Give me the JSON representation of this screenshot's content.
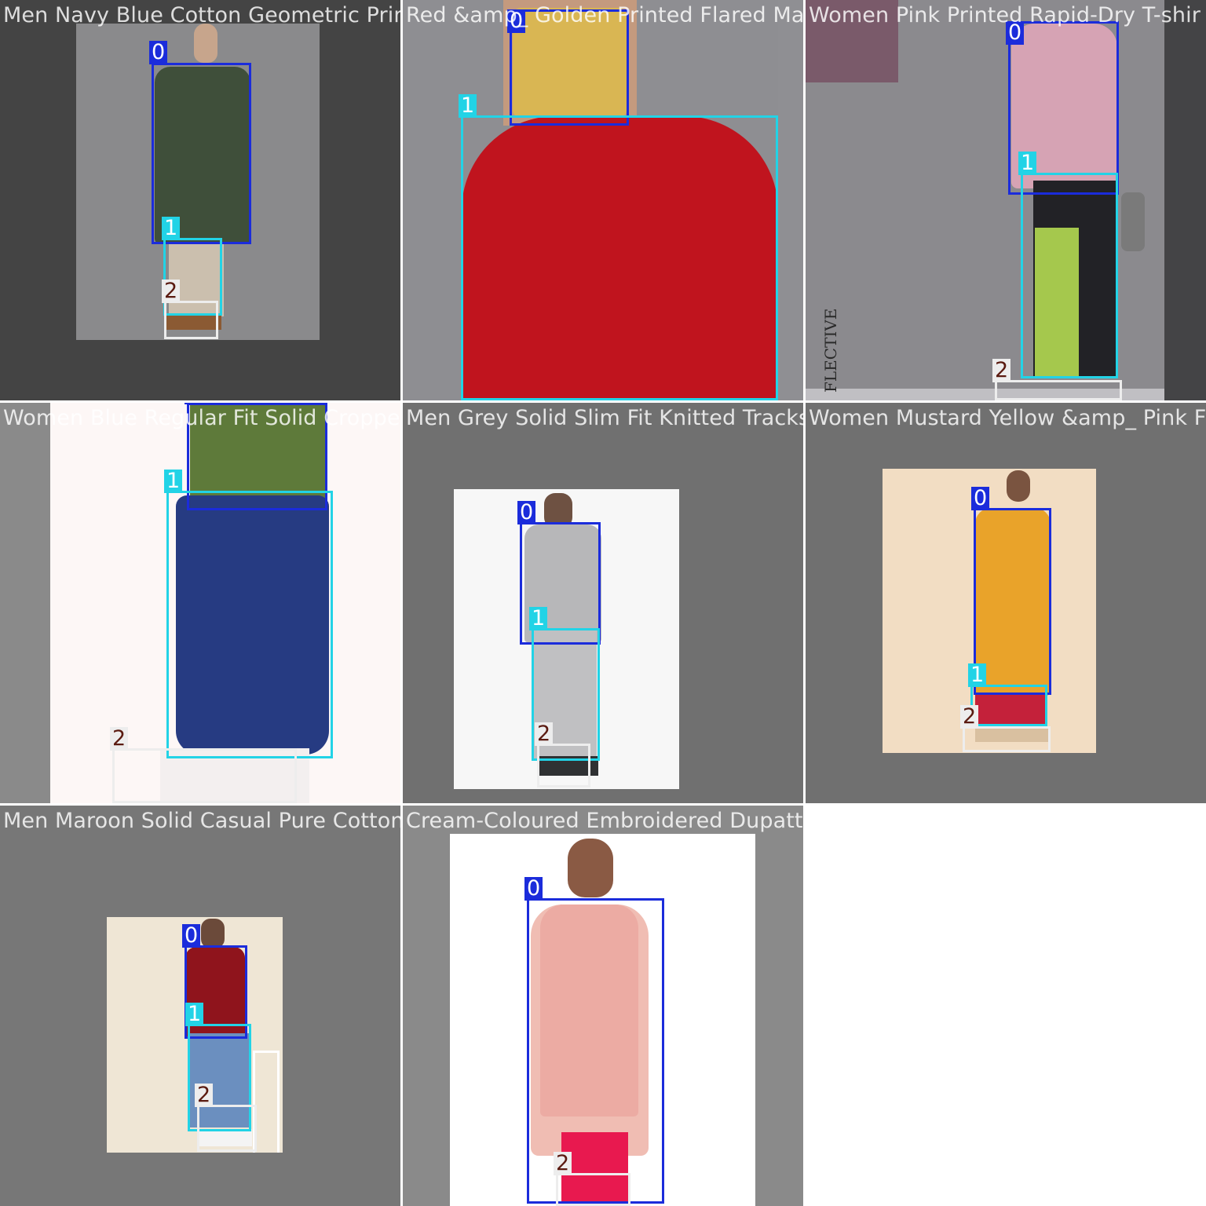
{
  "tiles": [
    {
      "title": "Men Navy Blue Cotton Geometric Printed K",
      "labels": [
        "0",
        "1",
        "2"
      ]
    },
    {
      "title": "Red &amp_ Golden Printed Flared Maxi Ski",
      "labels": [
        "0",
        "1"
      ]
    },
    {
      "title": "Women Pink Printed Rapid-Dry T-shir",
      "labels": [
        "0",
        "1",
        "2"
      ]
    },
    {
      "title": "Women Blue Regular Fit Solid Cropped Ch",
      "labels": [
        "0",
        "1",
        "2"
      ]
    },
    {
      "title": "Men Grey Solid Slim Fit Knitted Tracksu",
      "labels": [
        "0",
        "1",
        "2"
      ]
    },
    {
      "title": "Women Mustard Yellow &amp_ Pink F",
      "labels": [
        "0",
        "1",
        "2"
      ]
    },
    {
      "title": "Men Maroon Solid Casual Pure Cotton Shir",
      "labels": [
        "0",
        "1",
        "2"
      ]
    },
    {
      "title": "Cream-Coloured Embroidered Dupatta.jpg.j",
      "labels": [
        "0",
        "2"
      ]
    }
  ],
  "watermark_text": "FLECTIVE",
  "colors": {
    "class0": "#1b2cdb",
    "class1": "#22d3e6",
    "class2": "#ededed"
  }
}
